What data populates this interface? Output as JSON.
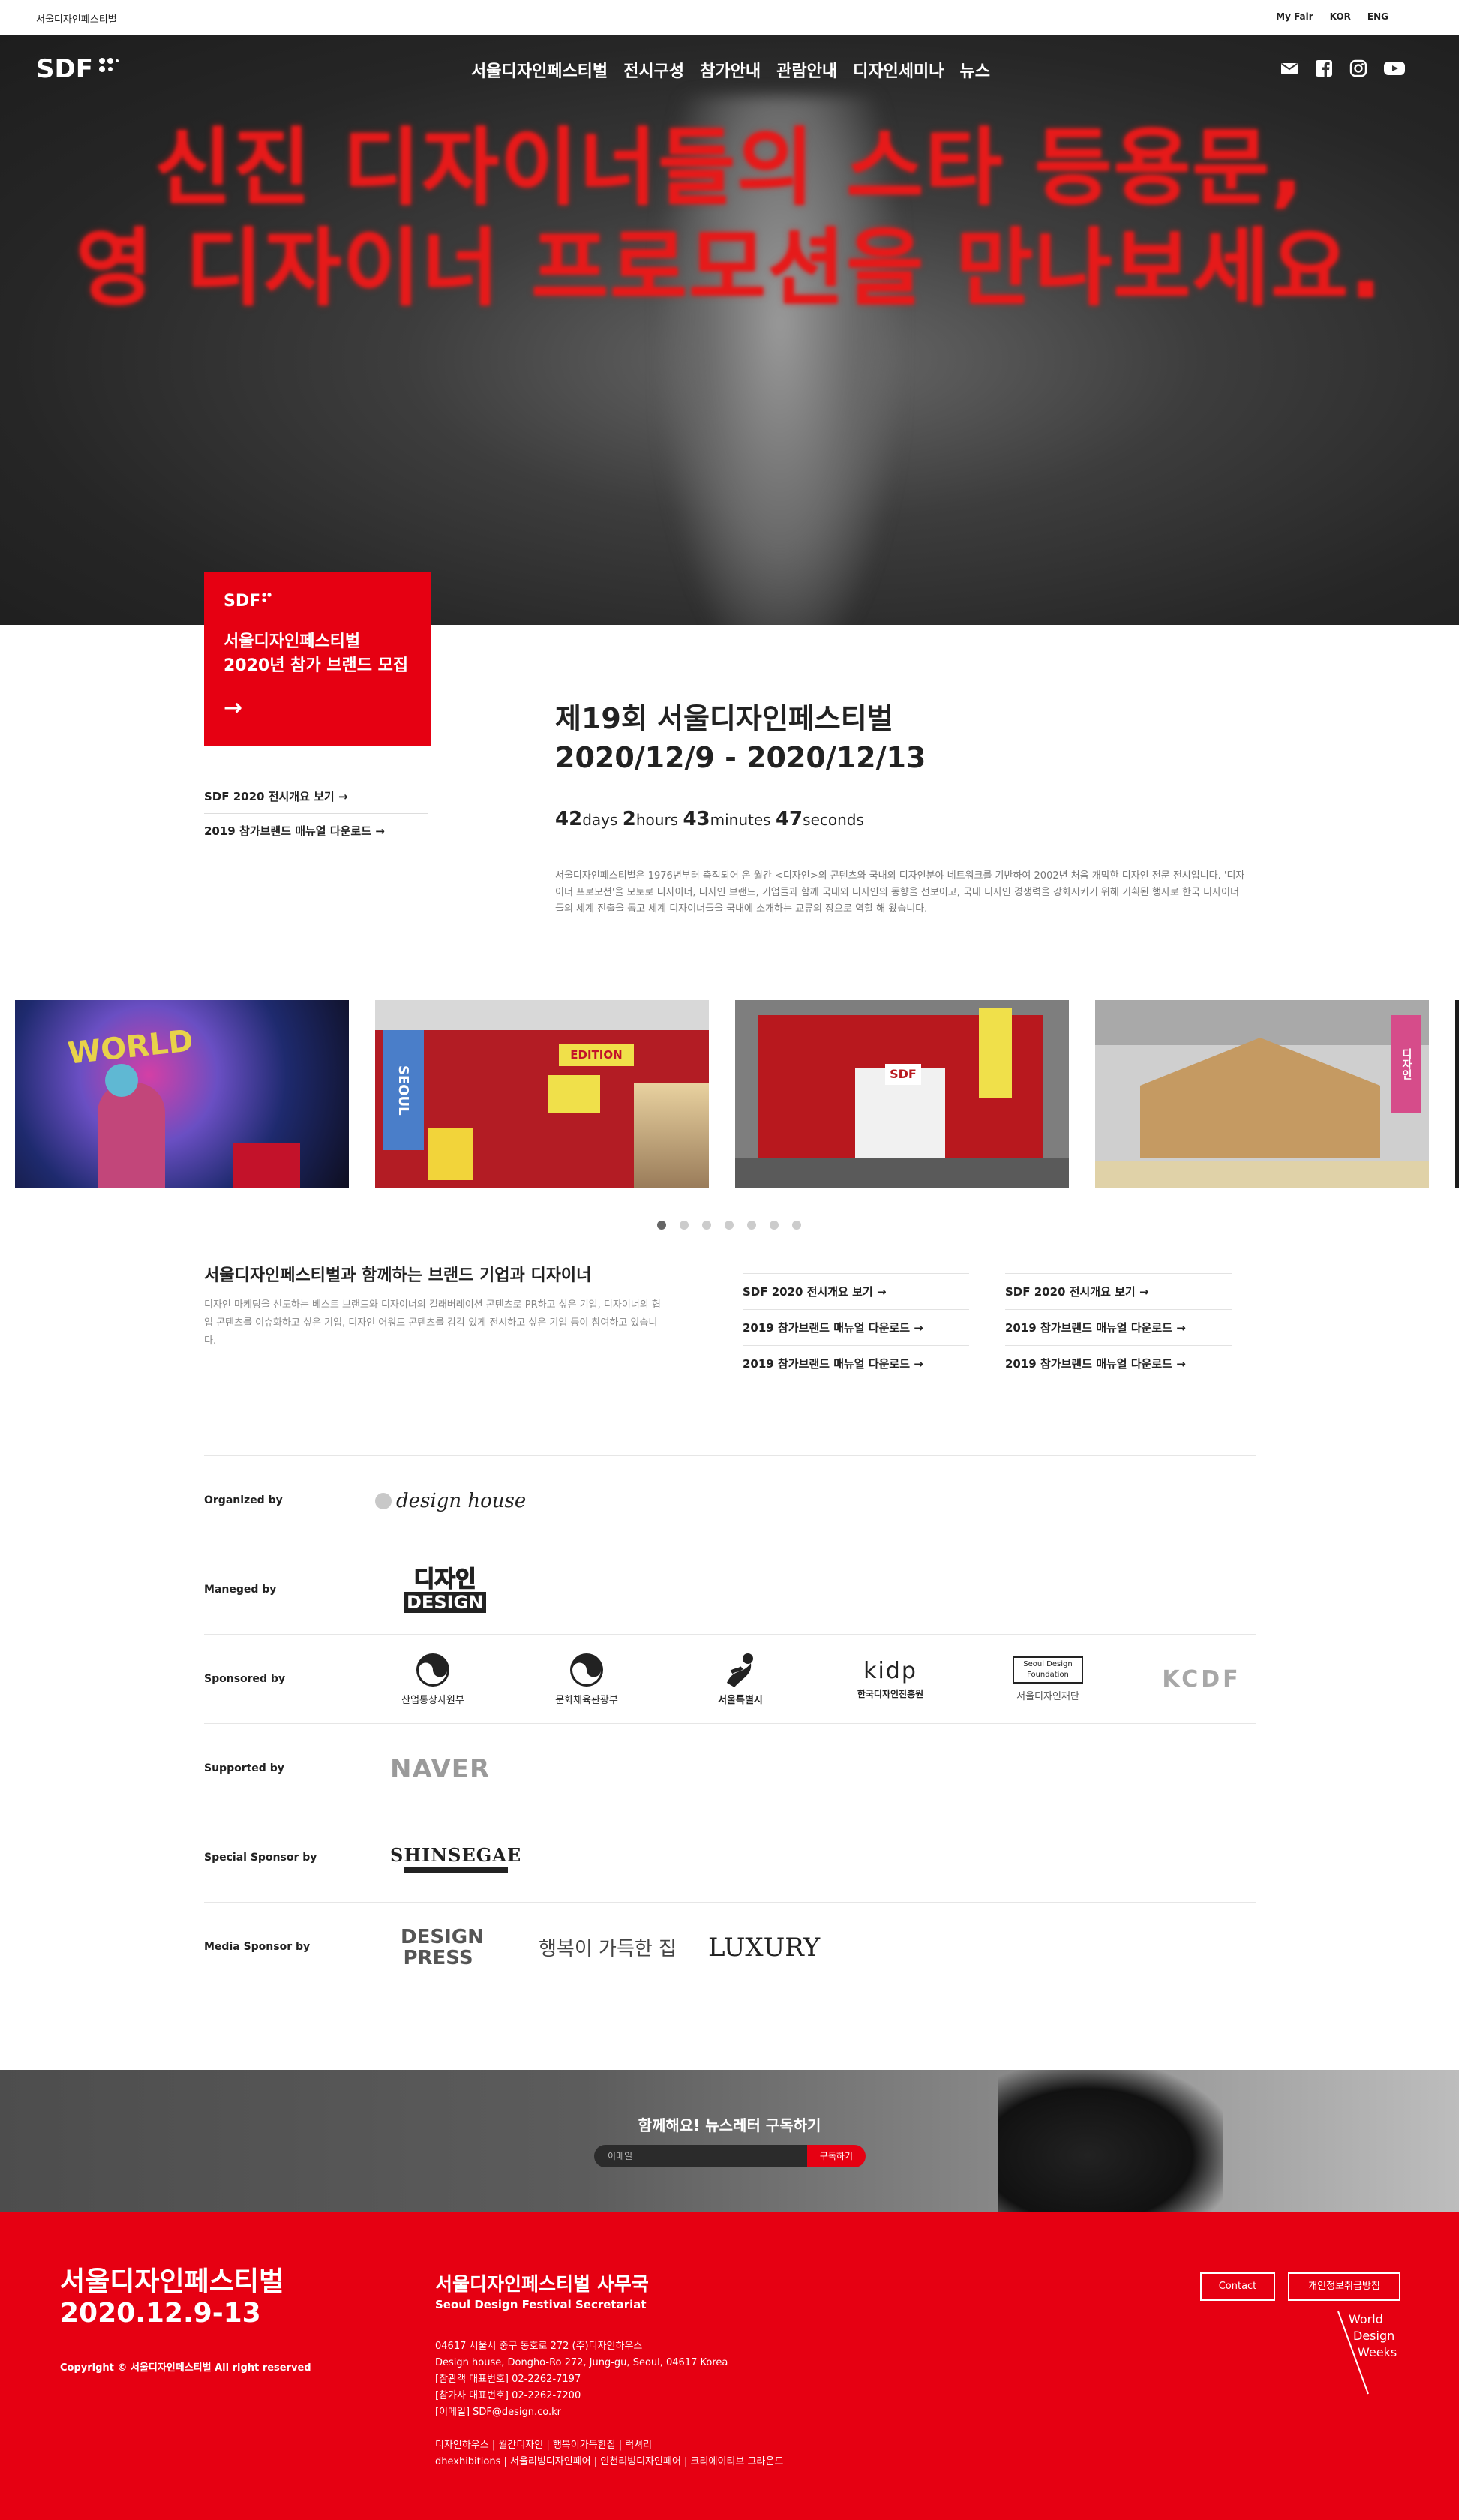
{
  "topbar": {
    "brand": "서울디자인페스티벌",
    "links": [
      "My Fair",
      "KOR",
      "ENG"
    ]
  },
  "nav": {
    "logo": "SDF",
    "items": [
      "서울디자인페스티벌",
      "전시구성",
      "참가안내",
      "관람안내",
      "디자인세미나",
      "뉴스"
    ],
    "social_icons": [
      "envelope-icon",
      "facebook-icon",
      "instagram-icon",
      "youtube-icon"
    ]
  },
  "hero": {
    "line1": "신진 디자이너들의 스타 등용문,",
    "line2": "영 디자이너 프로모션을 만나보세요."
  },
  "card": {
    "title_line1": "서울디자인페스티벌",
    "title_line2": "2020년 참가 브랜드 모집",
    "arrow": "→"
  },
  "side_links": [
    "SDF 2020 전시개요 보기 →",
    "2019 참가브랜드 매뉴얼 다운로드 →"
  ],
  "festival": {
    "title_line1": "제19회 서울디자인페스티벌",
    "title_line2": "2020/12/9 - 2020/12/13",
    "countdown": {
      "days": "42",
      "days_unit": "days",
      "hours": "2",
      "hours_unit": "hours",
      "minutes": "43",
      "minutes_unit": "minutes",
      "seconds": "47",
      "seconds_unit": "seconds"
    },
    "description": "서울디자인페스티벌은 1976년부터 축적되어 온 월간 <디자인>의 콘텐츠와 국내외 디자인분야 네트워크를 기반하여 2002년 처음 개막한 디자인 전문 전시입니다. '디자이너 프로모션'을 모토로 디자이너, 디자인 브랜드, 기업들과 함께 국내외 디자인의 동향을 선보이고, 국내 디자인 경쟁력을 강화시키기 위해 기획된 행사로 한국 디자이너들의 세계 진출을 돕고 세계 디자이너들을 국내에 소개하는 교류의 장으로 역할 해 왔습니다."
  },
  "gallery": {
    "photo_signs": [
      "WORLD",
      "SEOUL",
      "EDITION",
      "SDF",
      "디자인"
    ],
    "dots": 7,
    "active_dot": 0
  },
  "brands": {
    "title": "서울디자인페스티벌과 함께하는 브랜드 기업과 디자이너",
    "description": "디자인 마케팅을 선도하는 베스트 브랜드와 디자이너의 컬래버레이션 콘텐츠로 PR하고 싶은 기업, 디자이너의 협업 콘텐츠를 이슈화하고 싶은 기업, 디자인 어워드 콘텐츠를 감각 있게 전시하고 싶은 기업 등이 참여하고 있습니다.",
    "links_col1": [
      "SDF 2020 전시개요 보기 →",
      "2019 참가브랜드 매뉴얼 다운로드 →",
      "2019 참가브랜드 매뉴얼 다운로드 →"
    ],
    "links_col2": [
      "SDF 2020 전시개요 보기 →",
      "2019 참가브랜드 매뉴얼 다운로드 →",
      "2019 참가브랜드 매뉴얼 다운로드 →"
    ]
  },
  "sponsors": {
    "organized_label": "Organized by",
    "organized_logo": "design house",
    "managed_label": "Maneged by",
    "managed_logo_top": "디자인",
    "managed_logo_bottom": "DESIGN",
    "sponsored_label": "Sponsored by",
    "sponsored_logos": [
      "산업통상자원부",
      "문화체육관광부",
      "서울특별시",
      "한국디자인진흥원",
      "서울디자인재단",
      "KCDF"
    ],
    "kidp_mark": "kidp",
    "sdf_foundation_mark": "Seoul Design Foundation",
    "supported_label": "Supported by",
    "supported_logo": "NAVER",
    "special_label": "Special Sponsor by",
    "special_logo": "SHINSEGAE",
    "media_label": "Media Sponsor by",
    "media_logos": [
      "DESIGN PRESS",
      "행복이 가득한 집",
      "LUXURY"
    ]
  },
  "newsletter": {
    "title": "함께해요! 뉴스레터 구독하기",
    "email_placeholder": "이메일",
    "subscribe": "구독하기"
  },
  "footer": {
    "name": "서울디자인페스티벌",
    "dates": "2020.12.9-13",
    "copyright": "Copyright © 서울디자인페스티벌 All right reserved",
    "secretariat": "서울디자인페스티벌 사무국",
    "secretariat_en": "Seoul Design Festival Secretariat",
    "address": [
      "04617 서울시 중구 동호로 272 (주)디자인하우스",
      "Design house, Dongho-Ro 272, Jung-gu, Seoul, 04617 Korea",
      "[참관객 대표번호] 02-2262-7197",
      "[참가사 대표번호] 02-2262-7200",
      "[이메일] SDF@design.co.kr"
    ],
    "links_line1": "디자인하우스 | 월간디자인 | 행복이가득한집 | 럭셔리",
    "links_line2": "dhexhibitions | 서울리빙디자인페어 | 인천리빙디자인페어 | 크리에이티브 그라운드",
    "btn_contact": "Contact",
    "btn_privacy": "개인정보취급방침",
    "wdw": [
      "World",
      "Design",
      "Weeks"
    ]
  }
}
